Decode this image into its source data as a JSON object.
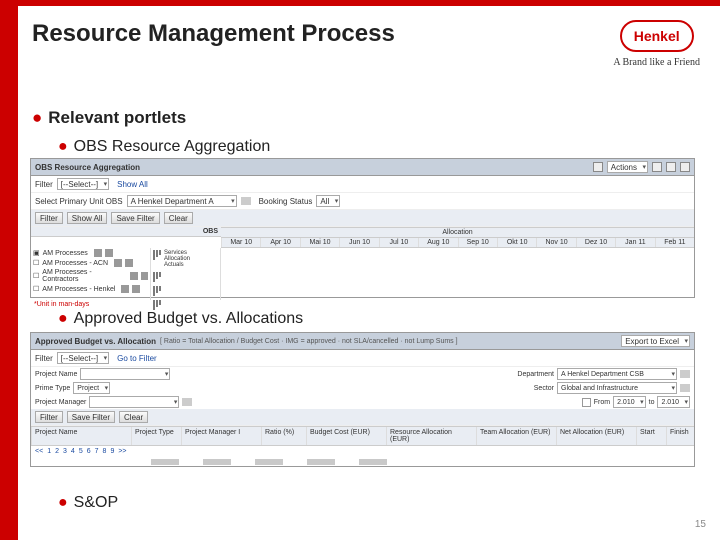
{
  "slide": {
    "title": "Resource Management Process",
    "page_number": "15",
    "brand": {
      "name": "Henkel",
      "tagline": "A Brand like a Friend"
    }
  },
  "bullets": {
    "l1": "Relevant portlets",
    "l2a": "OBS Resource Aggregation",
    "l2b": "Approved Budget vs. Allocations",
    "l2c": "S&OP"
  },
  "shot1": {
    "title": "OBS Resource Aggregation",
    "actions": "Actions",
    "filter_select": "[--Select--]",
    "label_unit": "Select Primary Unit OBS",
    "unit_value": "A Henkel Department A",
    "booking_label": "Booking Status",
    "booking_value": "All",
    "buttons": {
      "filter": "Filter",
      "showall": "Show All",
      "savefilter": "Save Filter",
      "clear": "Clear"
    },
    "alloc_header": "Allocation",
    "obs_col": "OBS",
    "legend": "Services\nAllocation\nActuals",
    "months": [
      "Mar 10",
      "Apr 10",
      "Mai 10",
      "Jun 10",
      "Jul 10",
      "Aug 10",
      "Sep 10",
      "Okt 10",
      "Nov 10",
      "Dez 10",
      "Jan 11",
      "Feb 11"
    ],
    "rows": [
      "AM Processes",
      "AM Processes - ACN",
      "AM Processes - Contractors",
      "AM Processes - Henkel"
    ],
    "footnote": "*Unit in man-days"
  },
  "shot2": {
    "title": "Approved Budget vs. Allocation",
    "subtitle": "[ Ratio = Total Allocation / Budget Cost · IMG = approved · not SLA/cancelled · not Lump Sums ]",
    "export": "Export to Excel",
    "gotofilter": "Go to Filter",
    "filter_select": "[--Select--]",
    "labels": {
      "proj_name": "Project Name",
      "prime_type": "Prime Type",
      "prime_val": "Project",
      "proj_mgr": "Project Manager",
      "dept": "Department",
      "dept_v": "A Henkel Department CSB",
      "sector": "Sector",
      "sector_v": "Global and Infrastructure",
      "from": "From",
      "from_v": "2.010",
      "to": "to",
      "to_v": "2.010"
    },
    "btns": {
      "filter": "Filter",
      "savefilter": "Save Filter",
      "clear": "Clear"
    },
    "cols": [
      "Project Name",
      "Project Type",
      "Project Manager I",
      "Ratio (%)",
      "Budget Cost (EUR)",
      "Resource Allocation (EUR)",
      "Team Allocation (EUR)",
      "Net Allocation (EUR)",
      "Start",
      "Finish"
    ],
    "pager": [
      "<<",
      "1",
      "2",
      "3",
      "4",
      "5",
      "6",
      "7",
      "8",
      "9",
      ">>"
    ]
  }
}
